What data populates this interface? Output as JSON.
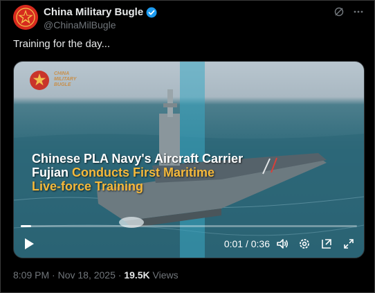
{
  "author": {
    "display_name": "China Military Bugle",
    "handle": "@ChinaMilBugle",
    "verified": true,
    "avatar_icon": "red-star-icon",
    "avatar_color": "#d62a1e"
  },
  "header_icons": [
    "grok-icon",
    "more-options-icon"
  ],
  "tweet": {
    "text": "Training for the day..."
  },
  "video": {
    "logo_text": "CHINA MILITARY BUGLE",
    "caption_line1": "Chinese PLA Navy's Aircraft Carrier",
    "caption_line2_white": "Fujian ",
    "caption_line2_highlight": "Conducts First Maritime",
    "caption_line3_highlight": "Live-force Training",
    "highlight_color": "#f5b93b",
    "current_time": "0:01",
    "duration": "0:36",
    "time_display": "0:01 / 0:36",
    "progress": 0.03,
    "controls": [
      "play-icon",
      "volume-icon",
      "settings-icon",
      "pip-icon",
      "fullscreen-icon"
    ]
  },
  "meta": {
    "timestamp": "8:09 PM · Nov 18, 2025 · ",
    "views_count": "19.5K",
    "views_label": " Views"
  }
}
